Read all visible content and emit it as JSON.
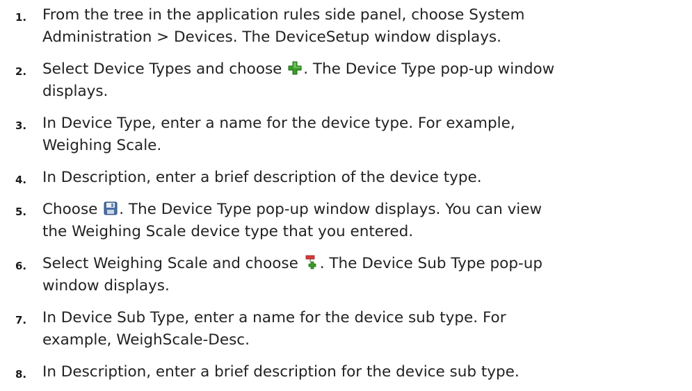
{
  "steps": [
    {
      "number": "1.",
      "line1": "From the tree in the application rules side panel, choose System",
      "line2": "Administration > Devices. The DeviceSetup window displays."
    },
    {
      "number": "2.",
      "before_icon": "Select Device Types and choose ",
      "icon": "add-plus-icon",
      "after_icon": ". The Device Type pop-up window",
      "line2": "displays."
    },
    {
      "number": "3.",
      "line1": "In Device Type, enter a name for the device type. For example,",
      "line2": "Weighing Scale."
    },
    {
      "number": "4.",
      "line1": "In Description, enter a brief description of the device type."
    },
    {
      "number": "5.",
      "before_icon": "Choose ",
      "icon": "save-disk-icon",
      "after_icon": ". The Device Type pop-up window displays. You can view",
      "line2": "the Weighing Scale device type that you entered."
    },
    {
      "number": "6.",
      "before_icon": "Select Weighing Scale and choose ",
      "icon": "add-subtype-icon",
      "after_icon": ". The Device Sub Type pop-up",
      "line2": "window displays."
    },
    {
      "number": "7.",
      "line1": "In Device Sub Type, enter a name for the device sub type. For",
      "line2": "example, WeighScale-Desc."
    },
    {
      "number": "8.",
      "line1": "In Description, enter a brief description for the device sub type."
    }
  ],
  "colors": {
    "text": "#222222",
    "plus_green": "#3a9a2a",
    "save_blue": "#4a6fa5",
    "subtype_red": "#d83a3a"
  }
}
